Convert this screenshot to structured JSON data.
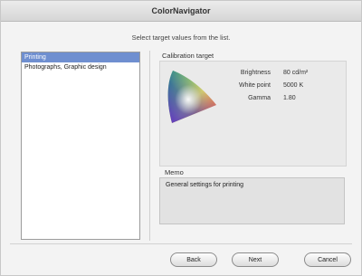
{
  "window": {
    "title": "ColorNavigator"
  },
  "instruction": "Select target values from the list.",
  "list": {
    "items": [
      {
        "label": "Printing",
        "selected": true
      },
      {
        "label": "Photographs, Graphic design",
        "selected": false
      }
    ]
  },
  "calibration": {
    "label": "Calibration target",
    "properties": [
      {
        "name": "Brightness",
        "value": "80 cd/m²"
      },
      {
        "name": "White point",
        "value": "5000 K"
      },
      {
        "name": "Gamma",
        "value": "1.80"
      }
    ]
  },
  "memo": {
    "label": "Memo",
    "text": "General settings for printing"
  },
  "buttons": {
    "back": "Back",
    "next": "Next",
    "cancel": "Cancel"
  }
}
